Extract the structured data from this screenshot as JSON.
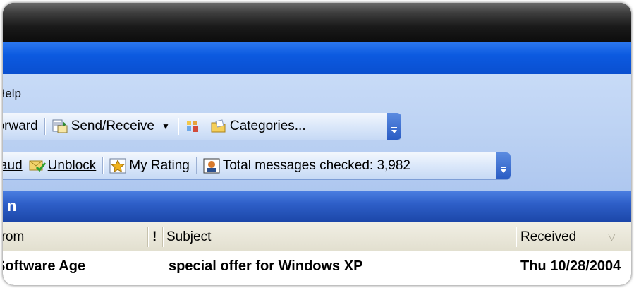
{
  "menubar": {
    "help_label": "Help"
  },
  "toolbar1": {
    "forward_label": "Forward",
    "send_receive_label": "Send/Receive",
    "categories_label": "Categories..."
  },
  "toolbar2": {
    "fraud_label": "Fraud",
    "unblock_label": "Unblock",
    "my_rating_label": "My Rating",
    "total_checked_label": "Total messages checked: 3,982"
  },
  "folder_bar": {
    "title": "n"
  },
  "columns": {
    "from": "From",
    "importance": "!",
    "subject": "Subject",
    "received": "Received",
    "sort_indicator": "▽"
  },
  "messages": [
    {
      "from": "Software Age",
      "subject": "special offer for Windows XP",
      "received": "Thu 10/28/2004"
    }
  ],
  "icons": {
    "send_receive": "send-receive-icon",
    "address": "address-book-icon",
    "categories": "categories-icon",
    "unblock": "unblock-icon",
    "rating": "star-icon",
    "stats": "spamfighter-icon"
  },
  "colors": {
    "accent_blue": "#0c5ae0",
    "toolbar_light": "#dde9fa",
    "header_beige": "#e9e6d8"
  }
}
